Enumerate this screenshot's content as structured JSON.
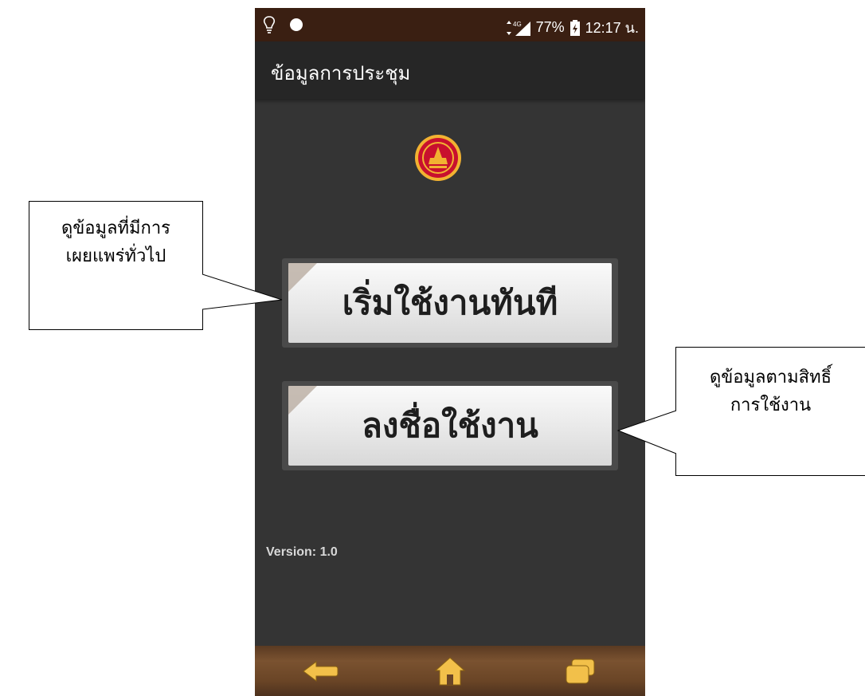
{
  "status_bar": {
    "signal_label": "4G",
    "battery_percent": "77%",
    "time": "12:17 น."
  },
  "app_bar": {
    "title": "ข้อมูลการประชุม"
  },
  "buttons": {
    "start_now": "เริ่มใช้งานทันที",
    "login": "ลงชื่อใช้งาน"
  },
  "version_text": "Version: 1.0",
  "callouts": {
    "left_line1": "ดูข้อมูลที่มีการ",
    "left_line2": "เผยแพร่ทั่วไป",
    "right_line1": "ดูข้อมูลตามสิทธิ์",
    "right_line2": "การใช้งาน"
  },
  "icons": {
    "status_left": [
      "lightbulb-icon",
      "circle-notification-icon"
    ],
    "status_right": [
      "data-arrows-icon",
      "signal-icon",
      "battery-charging-icon"
    ],
    "logo": "parliament-emblem-icon",
    "nav": [
      "back-icon",
      "home-icon",
      "recent-apps-icon"
    ]
  },
  "colors": {
    "status_bar": "#3a1f12",
    "app_bar": "#262626",
    "screen_bg": "#343434",
    "button_face": "#eeeeee",
    "nav_wood": "#7a5230",
    "logo_red": "#c8102e",
    "logo_gold": "#f2b231"
  }
}
